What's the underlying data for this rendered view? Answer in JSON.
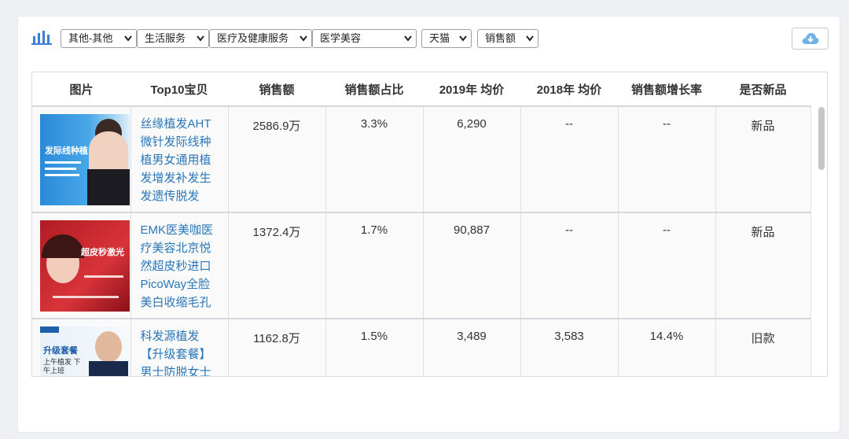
{
  "toolbar": {
    "filters": [
      {
        "value": "其他-其他"
      },
      {
        "value": "生活服务"
      },
      {
        "value": "医疗及健康服务"
      },
      {
        "value": "医学美容"
      },
      {
        "value": "天猫"
      },
      {
        "value": "销售额"
      }
    ]
  },
  "table": {
    "headers": [
      "图片",
      "Top10宝贝",
      "销售额",
      "销售额占比",
      "2019年 均价",
      "2018年 均价",
      "销售额增长率",
      "是否新品"
    ],
    "rows": [
      {
        "title": "丝缘植发AHT微针发际线种植男女通用植发增发补发生发遗传脱发",
        "sales": "2586.9万",
        "share": "3.3%",
        "price2019": "6,290",
        "price2018": "--",
        "growth": "--",
        "is_new": "新品",
        "thumb_text": "发际线种植"
      },
      {
        "title": "EMK医美咖医疗美容北京悦然超皮秒进口PicoWay全脸美白收缩毛孔",
        "sales": "1372.4万",
        "share": "1.7%",
        "price2019": "90,887",
        "price2018": "--",
        "growth": "--",
        "is_new": "新品",
        "thumb_text": "超皮秒激光"
      },
      {
        "title": "科发源植发【升级套餐】男士防脱女士",
        "sales": "1162.8万",
        "share": "1.5%",
        "price2019": "3,489",
        "price2018": "3,583",
        "growth": "14.4%",
        "is_new": "旧款",
        "thumb_text": "升级套餐",
        "thumb_sub": "上午植发 下午上班"
      }
    ]
  },
  "colors": {
    "accent": "#2a76b8",
    "chart_icon": "#3b7fd6",
    "cloud": "#6fb3e6"
  },
  "icons": {
    "toolbar": "bar-chart-icon",
    "download": "cloud-download-icon",
    "dropdown": "chevron-down-icon"
  }
}
